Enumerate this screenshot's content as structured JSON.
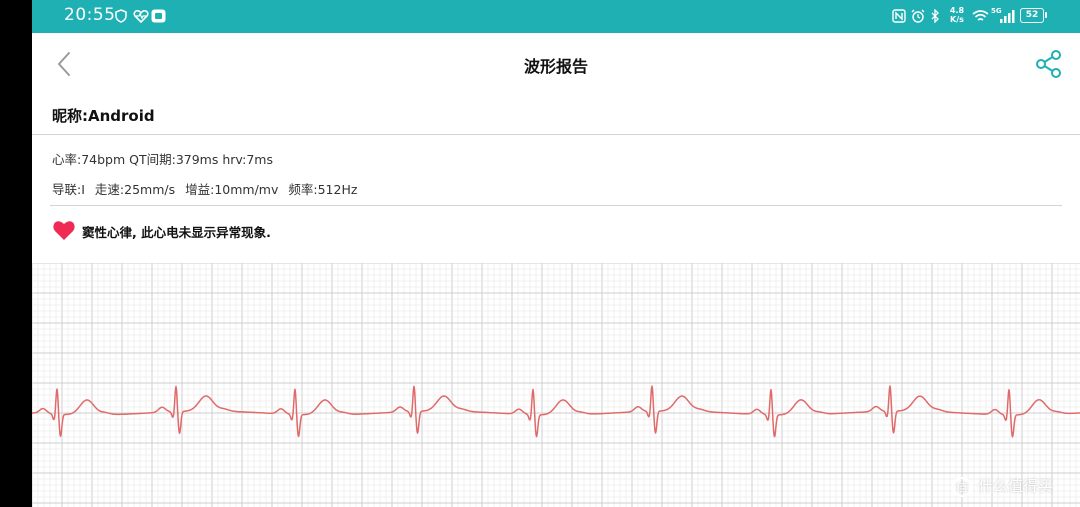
{
  "status_bar": {
    "time": "20:55",
    "network_speed": "4.8",
    "network_speed_unit": "K/s",
    "signal_label": "5G",
    "battery": "52"
  },
  "header": {
    "title": "波形报告"
  },
  "profile": {
    "nickname": "昵称:Android"
  },
  "report": {
    "line1": "心率:74bpm QT间期:379ms hrv:7ms",
    "lead": "导联:I",
    "speed": "走速:25mm/s",
    "gain": "增益:10mm/mv",
    "frequency": "频率:512Hz",
    "diagnosis": "窦性心律, 此心电未显示异常现象."
  },
  "colors": {
    "status_bar": "#1fb0b3",
    "accent": "#1fb0b3",
    "heart": "#ee2a55",
    "ecg_trace": "#e06a6a",
    "grid_minor": "#e6e6e6",
    "grid_major": "#cfcfcf"
  },
  "icons": {
    "back": "chevron-left-icon",
    "share": "share-icon",
    "heart": "heart-icon"
  },
  "watermark": {
    "text": "什么值得买"
  }
}
